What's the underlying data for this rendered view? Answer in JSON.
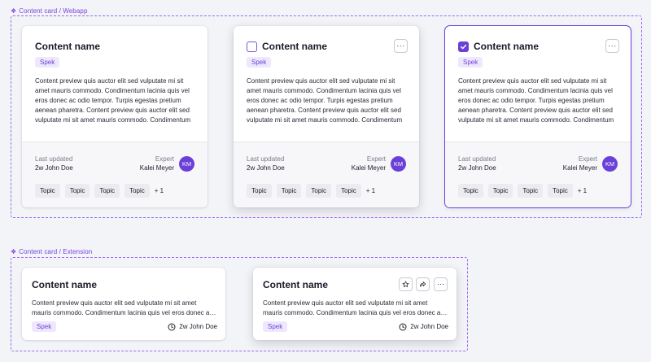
{
  "frames": {
    "webapp_label": "Content card / Webapp",
    "extension_label": "Content card / Extension"
  },
  "webapp_cards": [
    {
      "title": "Content name",
      "tag": "Spek",
      "preview": "Content preview quis auctor elit sed vulputate mi sit amet mauris commodo. Condimentum lacinia quis vel eros donec ac odio tempor. Turpis egestas pretium aenean pharetra. Content preview quis auctor elit sed vulputate mi sit amet mauris commodo. Condimentum lacinia quis vel eros",
      "updated_label": "Last updated",
      "updated_value": "2w John Doe",
      "expert_label": "Expert",
      "expert_name": "Kalei Meyer",
      "avatar_initials": "KM",
      "topics": [
        "Topic",
        "Topic",
        "Topic",
        "Topic"
      ],
      "more_topics": "+ 1"
    },
    {
      "title": "Content name",
      "tag": "Spek",
      "preview": "Content preview quis auctor elit sed vulputate mi sit amet mauris commodo. Condimentum lacinia quis vel eros donec ac odio tempor. Turpis egestas pretium aenean pharetra. Content preview quis auctor elit sed vulputate mi sit amet mauris commodo. Condimentum lacinia quis vel eros",
      "updated_label": "Last updated",
      "updated_value": "2w John Doe",
      "expert_label": "Expert",
      "expert_name": "Kalei Meyer",
      "avatar_initials": "KM",
      "topics": [
        "Topic",
        "Topic",
        "Topic",
        "Topic"
      ],
      "more_topics": "+ 1",
      "more_button": "···"
    },
    {
      "title": "Content name",
      "tag": "Spek",
      "preview": "Content preview quis auctor elit sed vulputate mi sit amet mauris commodo. Condimentum lacinia quis vel eros donec ac odio tempor. Turpis egestas pretium aenean pharetra. Content preview quis auctor elit sed vulputate mi sit amet mauris commodo. Condimentum lacinia quis vel eros",
      "updated_label": "Last updated",
      "updated_value": "2w John Doe",
      "expert_label": "Expert",
      "expert_name": "Kalei Meyer",
      "avatar_initials": "KM",
      "topics": [
        "Topic",
        "Topic",
        "Topic",
        "Topic"
      ],
      "more_topics": "+ 1",
      "more_button": "···"
    }
  ],
  "extension_cards": [
    {
      "title": "Content name",
      "preview_line1": "Content preview quis auctor elit sed vulputate mi sit amet",
      "preview_line2": "mauris commodo. Condimentum lacinia quis vel eros donec ac odio tempor.",
      "tag": "Spek",
      "time": "2w John Doe"
    },
    {
      "title": "Content name",
      "preview_line1": "Content preview quis auctor elit sed vulputate mi sit amet",
      "preview_line2": "mauris commodo. Condimentum lacinia quis vel eros donec ac odio tempor.",
      "tag": "Spek",
      "time": "2w John Doe",
      "more_button": "···"
    }
  ],
  "colors": {
    "accent": "#6a40d8",
    "frame": "#9b6bf0",
    "background": "#f3f4f7"
  }
}
